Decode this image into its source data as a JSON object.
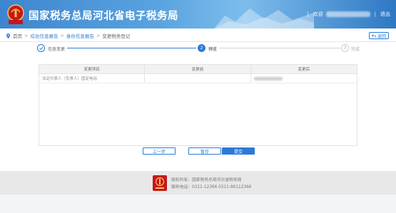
{
  "header": {
    "site_title": "国家税务总局河北省电子税务局",
    "welcome": "欢迎",
    "logout": "退出",
    "emblem_text": "中国税务"
  },
  "breadcrumb": {
    "items": [
      "首页",
      "综合信息报告",
      "身份信息报告",
      "变更税务登记"
    ]
  },
  "back_button": "返回",
  "steps": [
    {
      "number": "1",
      "label": "信息变更",
      "state": "done"
    },
    {
      "number": "2",
      "label": "预览",
      "state": "active"
    },
    {
      "number": "3",
      "label": "完成",
      "state": "pending"
    }
  ],
  "table": {
    "headers": [
      "变更项目",
      "变更前",
      "变更后"
    ],
    "rows": [
      [
        "法定代表人（负责人）固定电话",
        "",
        ""
      ]
    ]
  },
  "buttons": {
    "prev": "上一步",
    "save": "暂存",
    "submit": "提交"
  },
  "footer": {
    "copyright": "版权所有：国家税务总局河北省税务局",
    "hotline": "服务电话：0311-12366  0311-86112366"
  },
  "colors": {
    "primary": "#2c7ad6",
    "header_blue": "#3d86cf",
    "emblem_red": "#c8161d"
  }
}
